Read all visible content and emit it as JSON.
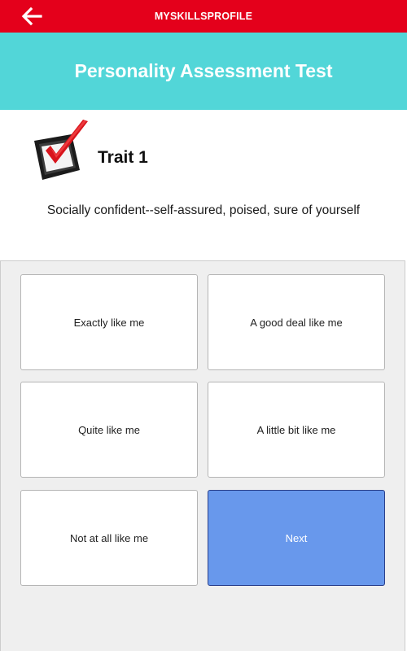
{
  "topbar": {
    "back_icon": "arrow-left-icon",
    "app_title": "MYSKILLSPROFILE",
    "color": "#e4001b"
  },
  "header": {
    "title": "Personality Assessment Test",
    "color": "#52d6d8"
  },
  "question": {
    "logo_icon": "checkmark-tablet-logo",
    "trait_title": "Trait 1",
    "description": "Socially confident--self-assured, poised, sure of yourself"
  },
  "options": [
    {
      "label": "Exactly like me"
    },
    {
      "label": "A good deal like me"
    },
    {
      "label": "Quite like me"
    },
    {
      "label": "A little bit like me"
    },
    {
      "label": "Not at all like me"
    }
  ],
  "next_button": {
    "label": "Next",
    "color": "#6898ec"
  }
}
